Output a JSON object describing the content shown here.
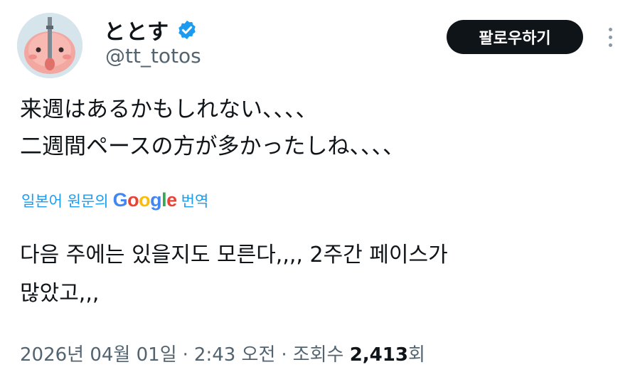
{
  "author": {
    "display_name": "ととす",
    "handle": "@tt_totos",
    "verified": true
  },
  "follow_button_label": "팔로우하기",
  "more_icon": "more-vertical-icon",
  "tweet": {
    "lines": [
      "来週はあるかもしれない、、、、",
      "二週間ペースの方が多かったしね、、、、"
    ]
  },
  "translation": {
    "prefix": "일본어 원문의",
    "brand_letters": [
      {
        "ch": "G",
        "color": "#4285F4"
      },
      {
        "ch": "o",
        "color": "#EA4335"
      },
      {
        "ch": "o",
        "color": "#FBBC05"
      },
      {
        "ch": "g",
        "color": "#4285F4"
      },
      {
        "ch": "l",
        "color": "#34A853"
      },
      {
        "ch": "e",
        "color": "#EA4335"
      }
    ],
    "suffix": "번역",
    "lines": [
      "다음 주에는 있을지도 모른다,,,, 2주간 페이스가",
      "많았고,,,"
    ]
  },
  "meta": {
    "date": "2026년 04월 01일",
    "separator": "·",
    "time": "2:43 오전",
    "views_label": "조회수",
    "views_count": "2,413",
    "views_unit": "회"
  },
  "colors": {
    "link": "#1d9bf0",
    "verified": "#1d9bf0",
    "secondary_text": "#536471",
    "follow_bg": "#0f1419"
  }
}
